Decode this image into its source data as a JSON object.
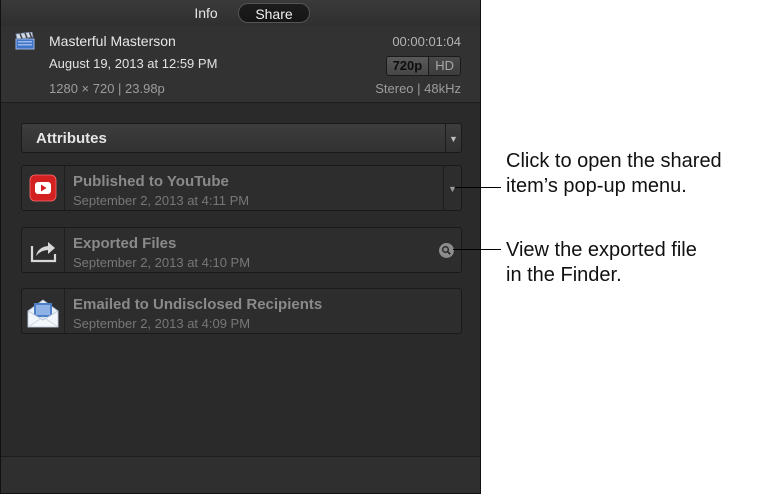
{
  "tabs": {
    "info": "Info",
    "share": "Share"
  },
  "header": {
    "title": "Masterful Masterson",
    "timecode": "00:00:01:04",
    "date": "August 19, 2013 at 12:59 PM",
    "res_selected": "720p",
    "res_other": "HD",
    "dims": "1280 × 720  |  23.98p",
    "audio": "Stereo  |  48kHz",
    "icon": "clapperboard-icon"
  },
  "attributes": {
    "label": "Attributes"
  },
  "items": [
    {
      "title": "Published to YouTube",
      "subtitle": "September 2, 2013 at 4:11 PM",
      "icon": "youtube-icon"
    },
    {
      "title": "Exported Files",
      "subtitle": "September 2, 2013 at 4:10 PM",
      "icon": "export-arrow-icon"
    },
    {
      "title": "Emailed to Undisclosed Recipients",
      "subtitle": "September 2, 2013 at 4:09 PM",
      "icon": "mail-envelope-icon"
    }
  ],
  "callouts": {
    "popup_line1": "Click to open the shared",
    "popup_line2": "item’s pop-up menu.",
    "finder_line1": "View the exported file",
    "finder_line2": "in the Finder."
  },
  "colors": {
    "panel_bg": "#2a2a2a",
    "youtube_red": "#d32020"
  }
}
